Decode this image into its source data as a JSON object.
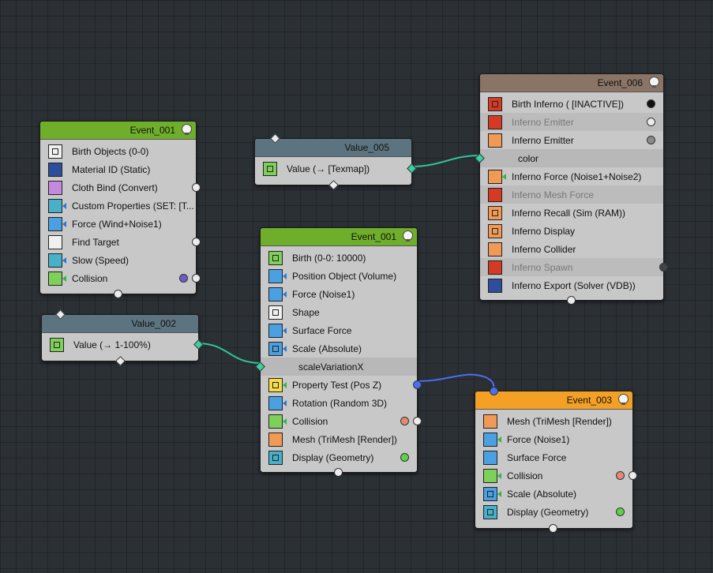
{
  "colors": {
    "background": "#2b3035",
    "event_header": "#6fae2a",
    "inferno_header": "#8a7466",
    "event3_header": "#f3a024",
    "value_header": "#5c7480",
    "wire_value": "#2fc39a",
    "wire_event": "#4c6ef0"
  },
  "event1_left": {
    "title": "Event_001",
    "rows": [
      {
        "label": "Birth Objects (0-0)",
        "icon": "birth-objects-icon"
      },
      {
        "label": "Material ID (Static)",
        "icon": "material-id-icon"
      },
      {
        "label": "Cloth Bind (Convert)",
        "icon": "cloth-bind-icon"
      },
      {
        "label": "Custom Properties (SET: [T...",
        "icon": "custom-properties-icon"
      },
      {
        "label": "Force (Wind+Noise1)",
        "icon": "force-icon"
      },
      {
        "label": "Find Target",
        "icon": "find-target-icon"
      },
      {
        "label": "Slow (Speed)",
        "icon": "slow-icon"
      },
      {
        "label": "Collision",
        "icon": "collision-icon"
      }
    ]
  },
  "value005": {
    "title": "Value_005",
    "row": "Value (→ [Texmap])"
  },
  "value002": {
    "title": "Value_002",
    "row": "Value (→ 1-100%)"
  },
  "event1_mid": {
    "title": "Event_001",
    "rows": [
      {
        "label": "Birth (0-0: 10000)",
        "icon": "birth-icon"
      },
      {
        "label": "Position Object (Volume)",
        "icon": "position-object-icon"
      },
      {
        "label": "Force (Noise1)",
        "icon": "force-icon"
      },
      {
        "label": "Shape",
        "icon": "shape-icon"
      },
      {
        "label": "Surface Force",
        "icon": "surface-force-icon"
      },
      {
        "label": "Scale (Absolute)",
        "icon": "scale-icon"
      },
      {
        "label": "scaleVariationX",
        "icon": ""
      },
      {
        "label": "Property Test (Pos Z)",
        "icon": "property-test-icon"
      },
      {
        "label": "Rotation (Random 3D)",
        "icon": "rotation-icon"
      },
      {
        "label": "Collision",
        "icon": "collision-icon"
      },
      {
        "label": "Mesh (TriMesh [Render])",
        "icon": "mesh-icon"
      },
      {
        "label": "Display (Geometry)",
        "icon": "display-icon"
      }
    ]
  },
  "event6": {
    "title": "Event_006",
    "rows": [
      {
        "label": "Birth Inferno ( [INACTIVE])",
        "icon": "birth-inferno-icon"
      },
      {
        "label": "Inferno Emitter",
        "icon": "inferno-emitter-icon"
      },
      {
        "label": "Inferno Emitter",
        "icon": "inferno-emitter-icon"
      },
      {
        "label": "color",
        "icon": ""
      },
      {
        "label": "Inferno Force (Noise1+Noise2)",
        "icon": "inferno-force-icon"
      },
      {
        "label": "Inferno Mesh Force",
        "icon": "inferno-mesh-force-icon"
      },
      {
        "label": "Inferno Recall (Sim (RAM))",
        "icon": "inferno-recall-icon"
      },
      {
        "label": "Inferno Display",
        "icon": "inferno-display-icon"
      },
      {
        "label": "Inferno Collider",
        "icon": "inferno-collider-icon"
      },
      {
        "label": "Inferno Spawn",
        "icon": "inferno-spawn-icon"
      },
      {
        "label": "Inferno Export (Solver (VDB))",
        "icon": "inferno-export-icon"
      }
    ]
  },
  "event3": {
    "title": "Event_003",
    "rows": [
      {
        "label": "Mesh (TriMesh [Render])",
        "icon": "mesh-icon"
      },
      {
        "label": "Force (Noise1)",
        "icon": "force-icon"
      },
      {
        "label": "Surface Force",
        "icon": "surface-force-icon"
      },
      {
        "label": "Collision",
        "icon": "collision-icon"
      },
      {
        "label": "Scale (Absolute)",
        "icon": "scale-icon"
      },
      {
        "label": "Display (Geometry)",
        "icon": "display-icon"
      }
    ]
  }
}
